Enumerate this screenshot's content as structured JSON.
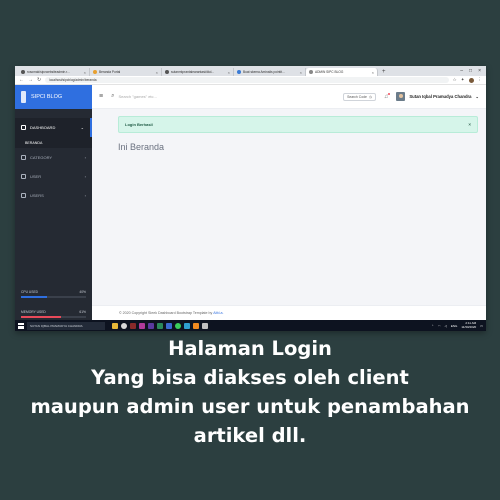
{
  "browser": {
    "tabs": [
      {
        "label": "rosomak/sipcwebsiteadmin.r..."
      },
      {
        "label": "Beranda Portal"
      },
      {
        "label": "sutanrrkprantalearantasi/dkd..."
      },
      {
        "label": "Buat skema Aminalis pointit..."
      },
      {
        "label": "ADMIN SIPC BLOG",
        "active": true
      }
    ],
    "url": "localhost/sipcblog/admin/beranda"
  },
  "app": {
    "brand": "SIPCI BLOG",
    "sidebar": {
      "items": [
        {
          "label": "DASHBOARD"
        },
        {
          "label": "CATEGORY"
        },
        {
          "label": "USER"
        },
        {
          "label": "USERS"
        }
      ],
      "sub_item": "BERANDA",
      "stats": [
        {
          "label": "CPU USED",
          "value": "40%",
          "fill": 0.4,
          "color": "#2f6fe0"
        },
        {
          "label": "MEMORY USED",
          "value": "61%",
          "fill": 0.61,
          "color": "#e84a5a"
        }
      ]
    },
    "topbar": {
      "search_placeholder": "Search \"games\" etc...",
      "cari_button": "Search Code",
      "user_name": "Sutan Iqbal Pramudya Chandra"
    },
    "alert": "Login Berhasil",
    "page_title": "Ini Beranda",
    "footer": {
      "text": "© 2020 Copyright Sleek Dashboard Bootstrap Template by ",
      "link": "Alfd.a."
    }
  },
  "taskbar": {
    "search_text": "SUTAN IQBAL PRAMUDYA CHANDRA",
    "lang": "ENG",
    "time": "2:11 AM",
    "date": "11/30/2020"
  },
  "caption": {
    "line1": "Halaman Login",
    "line2": "Yang bisa diakses oleh client",
    "line3": "maupun admin user untuk penambahan",
    "line4": "artikel dll."
  }
}
